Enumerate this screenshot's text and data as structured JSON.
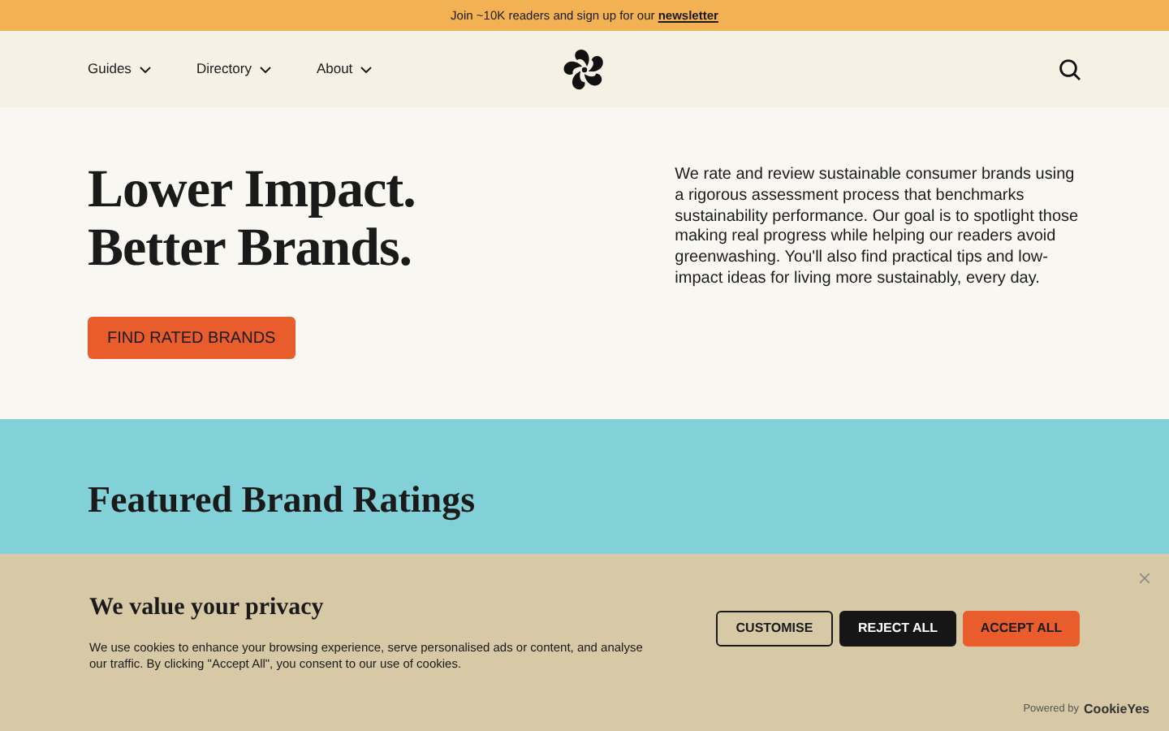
{
  "announcement": {
    "text": "Join ~10K readers and sign up for our ",
    "link": "newsletter"
  },
  "nav": {
    "items": [
      {
        "label": "Guides"
      },
      {
        "label": "Directory"
      },
      {
        "label": "About"
      }
    ]
  },
  "hero": {
    "headline": [
      "Lower Impact.",
      "Better Brands."
    ],
    "button": "FIND RATED BRANDS",
    "description": "We rate and review sustainable consumer brands using a rigorous assessment process that benchmarks sustainability performance. Our goal is to spotlight those making real progress while helping our readers avoid greenwashing. You'll also find practical tips and low-impact ideas for living more sustainably, every day."
  },
  "featured": {
    "title": "Featured Brand Ratings"
  },
  "cookie_banner": {
    "title": "We value your privacy",
    "text": "We use cookies to enhance your browsing experience, serve personalised ads or content, and analyse our traffic. By clicking \"Accept All\", you consent to our use of cookies.",
    "buttons": [
      {
        "label": "CUSTOMISE",
        "kind": "outline"
      },
      {
        "label": "REJECT ALL",
        "kind": "dark"
      },
      {
        "label": "ACCEPT ALL",
        "kind": "accent"
      }
    ],
    "powered_by": "Powered by",
    "brand": "CookieYes"
  }
}
